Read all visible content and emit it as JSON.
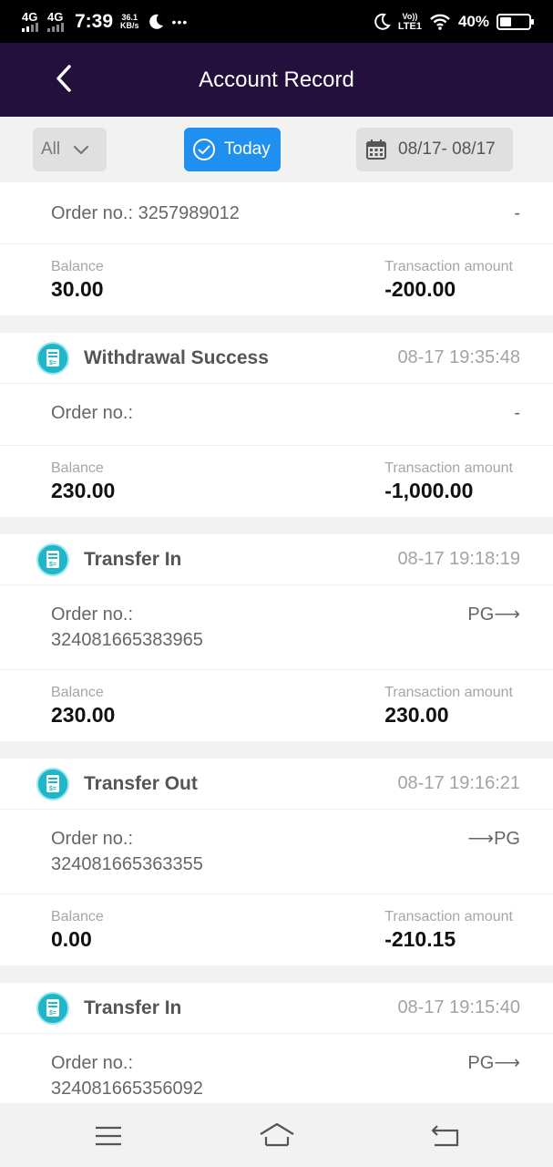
{
  "status_bar": {
    "net1": "4G",
    "net2": "4G",
    "time": "7:39",
    "speed_value": "36.1",
    "speed_unit": "KB/s",
    "more": "•••",
    "volte_top": "Vo))",
    "volte_bottom": "LTE1",
    "battery_percent": "40%",
    "battery_level": 0.4
  },
  "header": {
    "title": "Account Record"
  },
  "filters": {
    "type_label": "All",
    "today_label": "Today",
    "date_range": "08/17- 08/17"
  },
  "records": [
    {
      "show_head": false,
      "type": "",
      "time": "",
      "order_label": "Order no.: 3257989012",
      "order_number": "",
      "order_right": "-",
      "balance_label": "Balance",
      "balance": "30.00",
      "amount_label": "Transaction amount",
      "amount": "-200.00",
      "amount_sign": "neg"
    },
    {
      "show_head": true,
      "type": "Withdrawal Success",
      "time": "08-17 19:35:48",
      "order_label": "Order no.:",
      "order_number": "",
      "order_right": "-",
      "balance_label": "Balance",
      "balance": "230.00",
      "amount_label": "Transaction amount",
      "amount": "-1,000.00",
      "amount_sign": "neg"
    },
    {
      "show_head": true,
      "type": "Transfer In",
      "time": "08-17 19:18:19",
      "order_label": "Order no.:",
      "order_number": "324081665383965",
      "order_right": "PG⟶",
      "balance_label": "Balance",
      "balance": "230.00",
      "amount_label": "Transaction amount",
      "amount": "230.00",
      "amount_sign": "pos"
    },
    {
      "show_head": true,
      "type": "Transfer Out",
      "time": "08-17 19:16:21",
      "order_label": "Order no.:",
      "order_number": "324081665363355",
      "order_right": "⟶PG",
      "balance_label": "Balance",
      "balance": "0.00",
      "amount_label": "Transaction amount",
      "amount": "-210.15",
      "amount_sign": "neg"
    },
    {
      "show_head": true,
      "type": "Transfer In",
      "time": "08-17 19:15:40",
      "order_label": "Order no.:",
      "order_number": "324081665356092",
      "order_right": "PG⟶",
      "balance_label": "",
      "balance": "",
      "amount_label": "",
      "amount": "",
      "amount_sign": "pos"
    }
  ],
  "colors": {
    "header_bg": "#23103d",
    "today_active": "#1f8ff0",
    "negative": "#e15a3c",
    "positive": "#5cc35a",
    "record_icon": "#1fb6c9"
  },
  "icons": {
    "back": "chevron-left-icon",
    "dropdown": "chevron-down-icon",
    "today": "check-circle-icon",
    "calendar": "calendar-icon",
    "record": "receipt-icon",
    "nav_menu": "menu-icon",
    "nav_home": "home-icon",
    "nav_back": "back-icon"
  }
}
